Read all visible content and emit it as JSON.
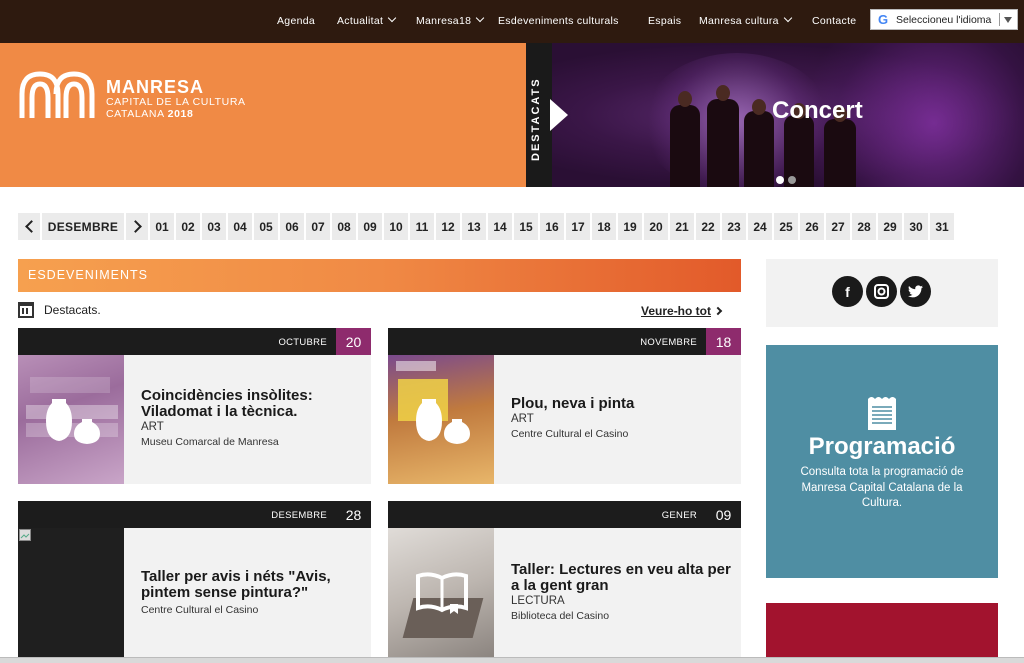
{
  "nav": {
    "items": [
      {
        "label": "Agenda",
        "dropdown": false
      },
      {
        "label": "Actualitat",
        "dropdown": true
      },
      {
        "label": "Manresa18",
        "dropdown": true
      },
      {
        "label": "Esdeveniments culturals",
        "dropdown": false
      },
      {
        "label": "Espais",
        "dropdown": false
      },
      {
        "label": "Manresa cultura",
        "dropdown": true
      },
      {
        "label": "Contacte",
        "dropdown": false
      }
    ],
    "language_select": "Seleccioneu l'idioma"
  },
  "brand": {
    "title": "MANRESA",
    "subtitle_line1": "CAPITAL DE LA CULTURA",
    "subtitle_line2_a": "CATALANA ",
    "subtitle_line2_b": "2018",
    "color": "#f08a45"
  },
  "featured": {
    "tab_label": "DESTACATS",
    "slide_title": "Concert",
    "slides": 2,
    "active_slide": 1
  },
  "datebar": {
    "month": "DESEMBRE",
    "days": [
      "01",
      "02",
      "03",
      "04",
      "05",
      "06",
      "07",
      "08",
      "09",
      "10",
      "11",
      "12",
      "13",
      "14",
      "15",
      "16",
      "17",
      "18",
      "19",
      "20",
      "21",
      "22",
      "23",
      "24",
      "25",
      "26",
      "27",
      "28",
      "29",
      "30",
      "31"
    ]
  },
  "events": {
    "header": "ESDEVENIMENTS",
    "subheader": "Destacats.",
    "see_all": "Veure-ho tot",
    "cards": [
      {
        "month": "OCTUBRE",
        "day": "20",
        "day_color": "#8e2b6d",
        "title": "Coincidències insòlites: Viladomat i la tècnica.",
        "category": "ART",
        "place": "Museu Comarcal de Manresa",
        "icon": "vases-icon"
      },
      {
        "month": "NOVEMBRE",
        "day": "18",
        "day_color": "#8e2b6d",
        "title": "Plou, neva i pinta",
        "category": "ART",
        "place": "Centre Cultural el Casino",
        "icon": "vases-icon"
      },
      {
        "month": "DESEMBRE",
        "day": "28",
        "day_color": "#1c1c1c",
        "title": "Taller per avis i néts \"Avis, pintem sense pintura?\"",
        "category": "",
        "place": "Centre Cultural el Casino",
        "icon": "broken-image-icon"
      },
      {
        "month": "GENER",
        "day": "09",
        "day_color": "#1c1c1c",
        "title": "Taller: Lectures en veu alta per a la gent gran",
        "category": "LECTURA",
        "place": "Biblioteca del Casino",
        "icon": "book-icon"
      }
    ]
  },
  "sidebar": {
    "social": [
      {
        "name": "facebook-icon",
        "glyph": "f"
      },
      {
        "name": "instagram-icon",
        "glyph": "◙"
      },
      {
        "name": "twitter-icon",
        "glyph": "🐦"
      }
    ],
    "programacio_title": "Programació",
    "programacio_text": "Consulta tota la programació de Manresa Capital Catalana de la Cultura.",
    "programacio_color": "#4f8ea3"
  }
}
